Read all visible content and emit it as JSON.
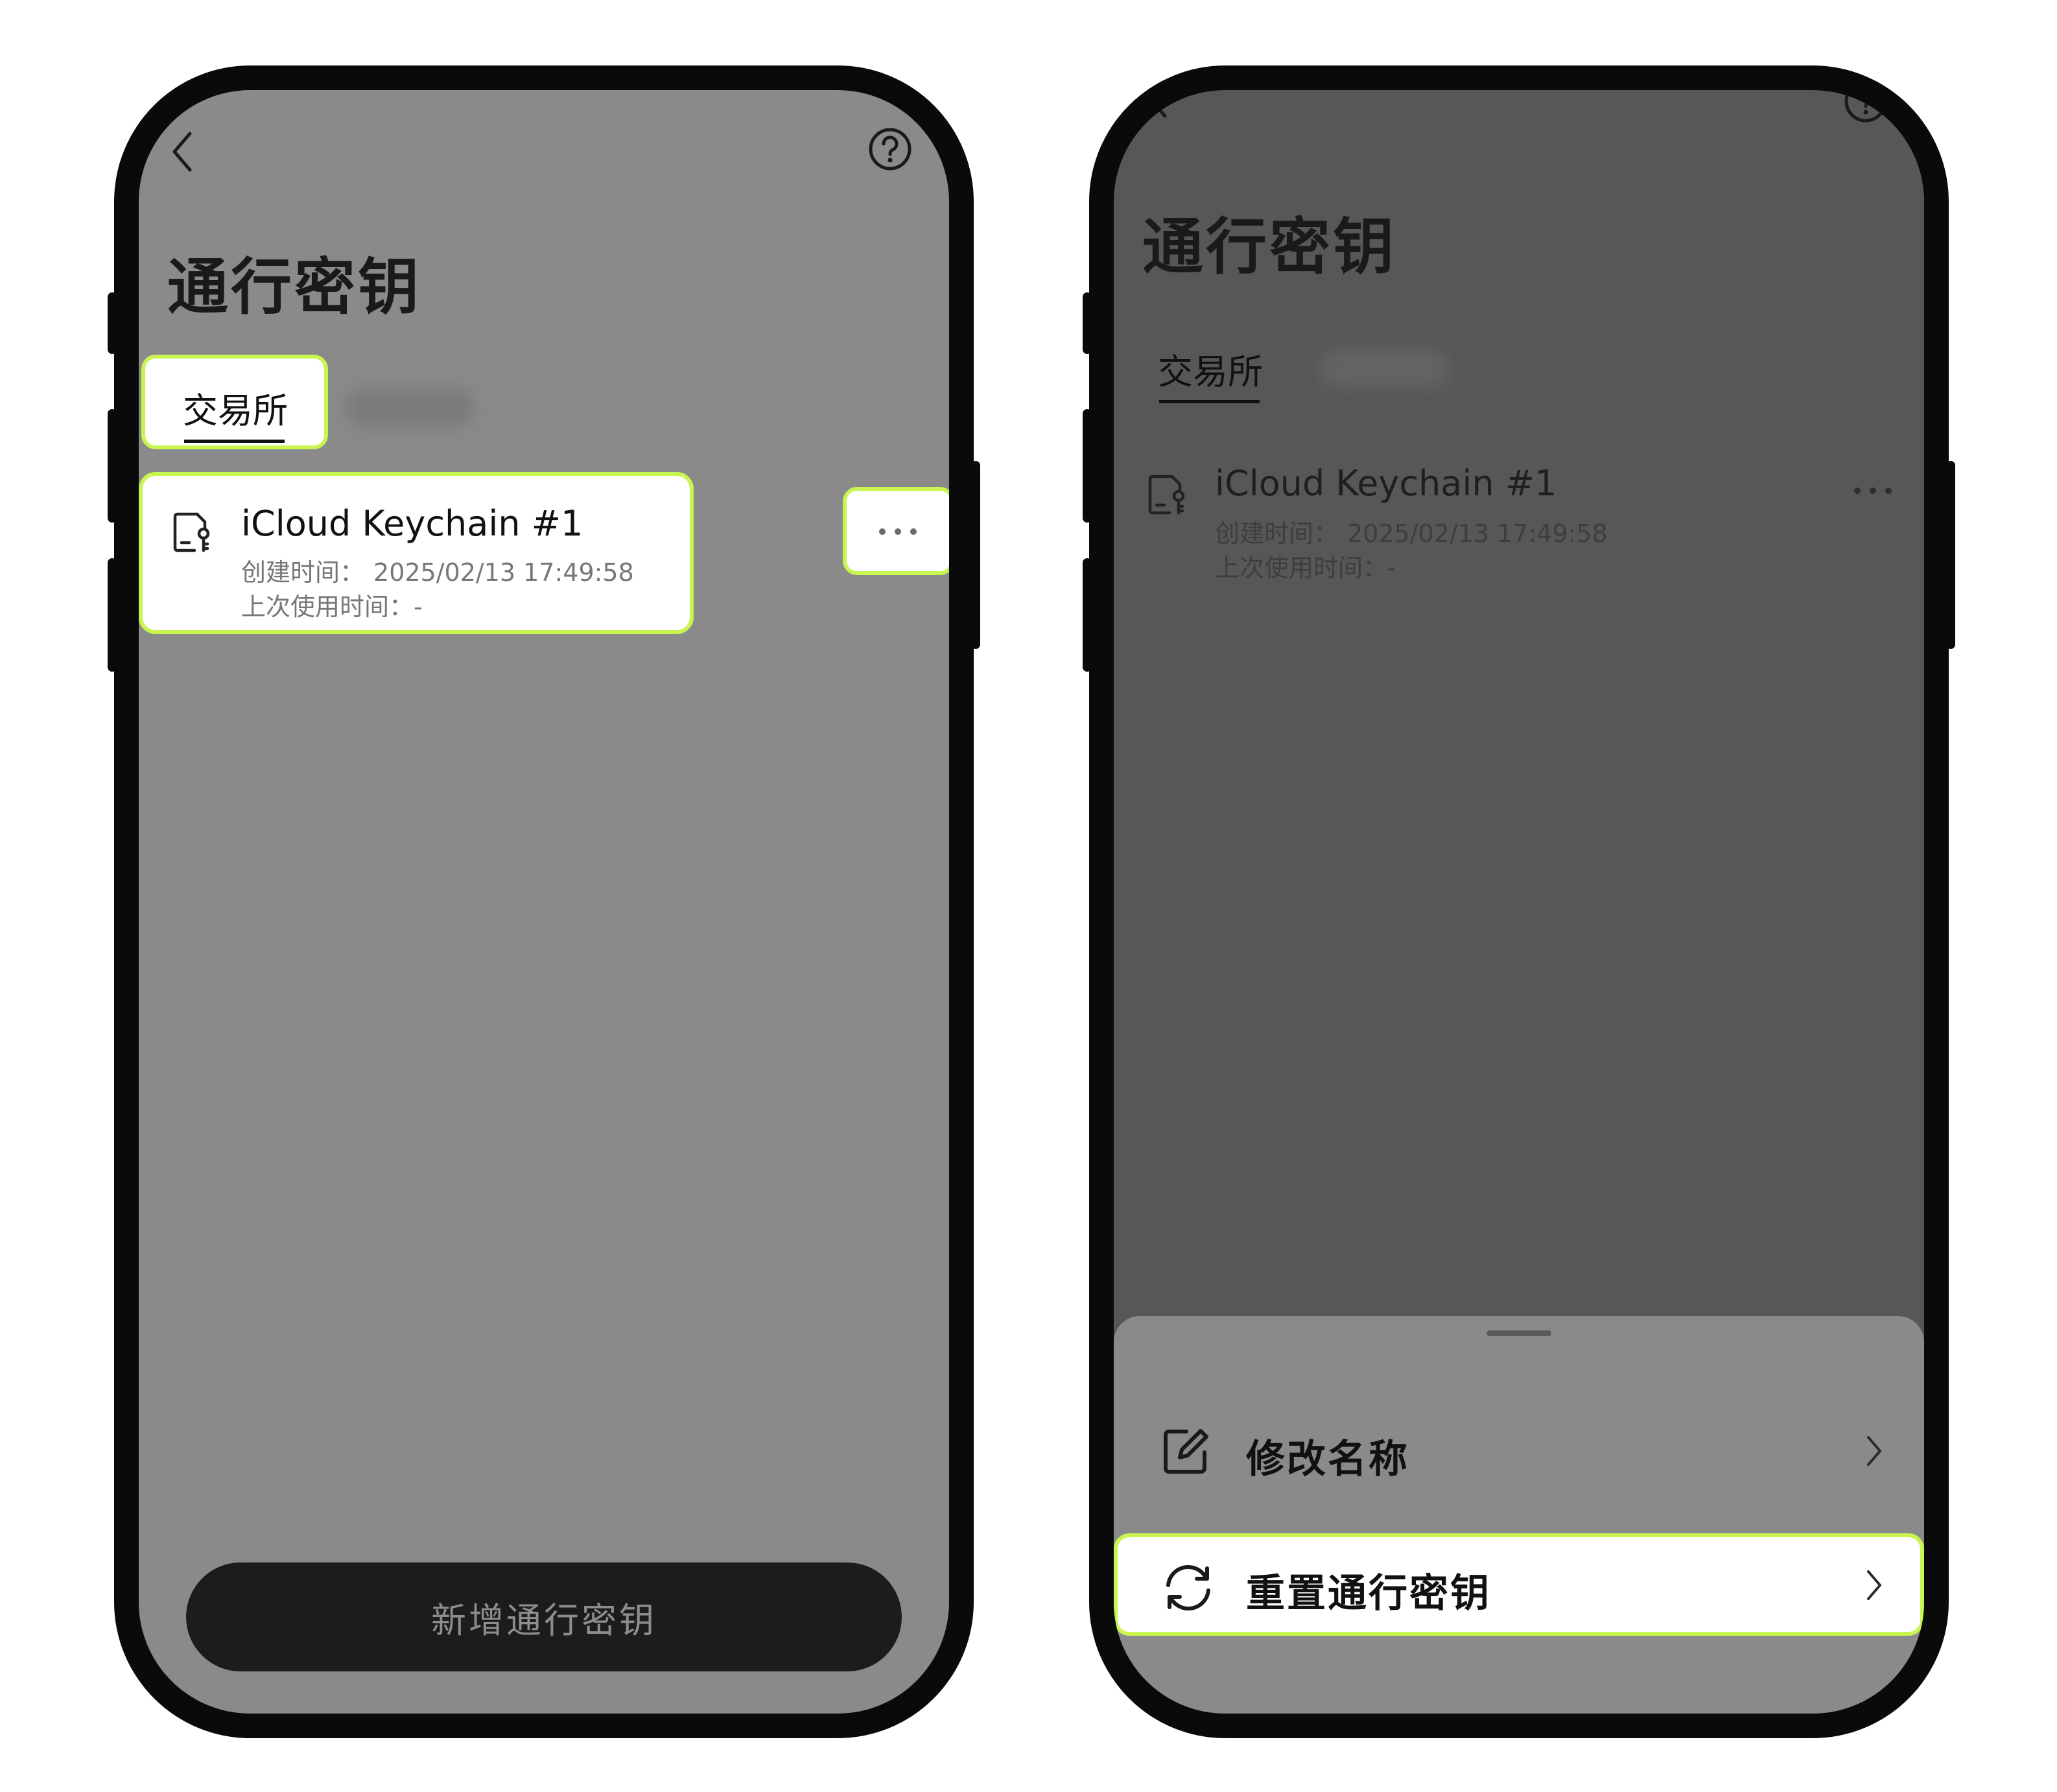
{
  "left_screen": {
    "title": "通行密钥",
    "tab_exchange": "交易所",
    "item": {
      "name": "iCloud Keychain #1",
      "created_label": "创建时间：",
      "created_value": "2025/02/13 17:49:58",
      "last_used_label": "上次使用时间：",
      "last_used_value": "-"
    },
    "add_button": "新增通行密钥",
    "highlight_color": "#c8f550"
  },
  "right_screen": {
    "title": "通行密钥",
    "tab_exchange": "交易所",
    "item": {
      "name": "iCloud Keychain #1",
      "created_label": "创建时间：",
      "created_value": "2025/02/13 17:49:58",
      "last_used_label": "上次使用时间：",
      "last_used_value": "-"
    },
    "sheet": {
      "rename_label": "修改名称",
      "reset_label": "重置通行密钥"
    }
  },
  "icons": {
    "back": "chevron-left-icon",
    "help": "question-circle-icon",
    "passkey": "key-document-icon",
    "more": "ellipsis-icon",
    "edit": "edit-icon",
    "refresh": "refresh-icon",
    "chevron": "chevron-right-icon"
  }
}
